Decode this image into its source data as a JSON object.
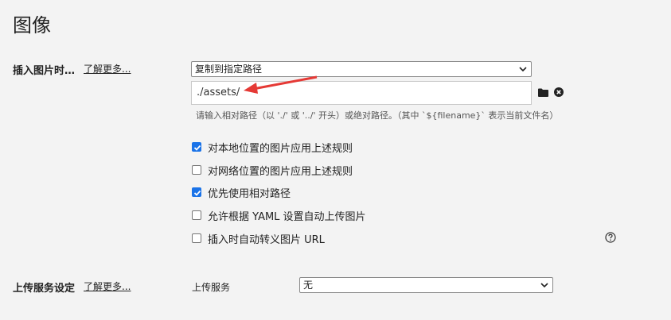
{
  "page": {
    "title": "图像"
  },
  "insert_section": {
    "label": "插入图片时…",
    "learn_more": "了解更多...",
    "action_select": {
      "selected": "复制到指定路径",
      "icon": "chevron-down-icon"
    },
    "path_input": {
      "value": "./assets/"
    },
    "folder_icon": "folder-icon",
    "clear_icon": "close-circle-icon",
    "hint": "请输入相对路径（以 './' 或 '../' 开头）或绝对路径。（其中 `${filename}` 表示当前文件名）",
    "options": [
      {
        "label": "对本地位置的图片应用上述规则",
        "checked": true
      },
      {
        "label": "对网络位置的图片应用上述规则",
        "checked": false
      },
      {
        "label": "优先使用相对路径",
        "checked": true
      },
      {
        "label": "允许根据 YAML 设置自动上传图片",
        "checked": false
      },
      {
        "label": "插入时自动转义图片 URL",
        "checked": false
      }
    ],
    "help_icon": "question-circle-icon"
  },
  "upload_section": {
    "label": "上传服务设定",
    "learn_more": "了解更多...",
    "service_label": "上传服务",
    "service_select": {
      "selected": "无"
    }
  },
  "colors": {
    "accent": "#1a73e8",
    "annotation_arrow": "#e53935",
    "background": "#f3f3f3"
  }
}
